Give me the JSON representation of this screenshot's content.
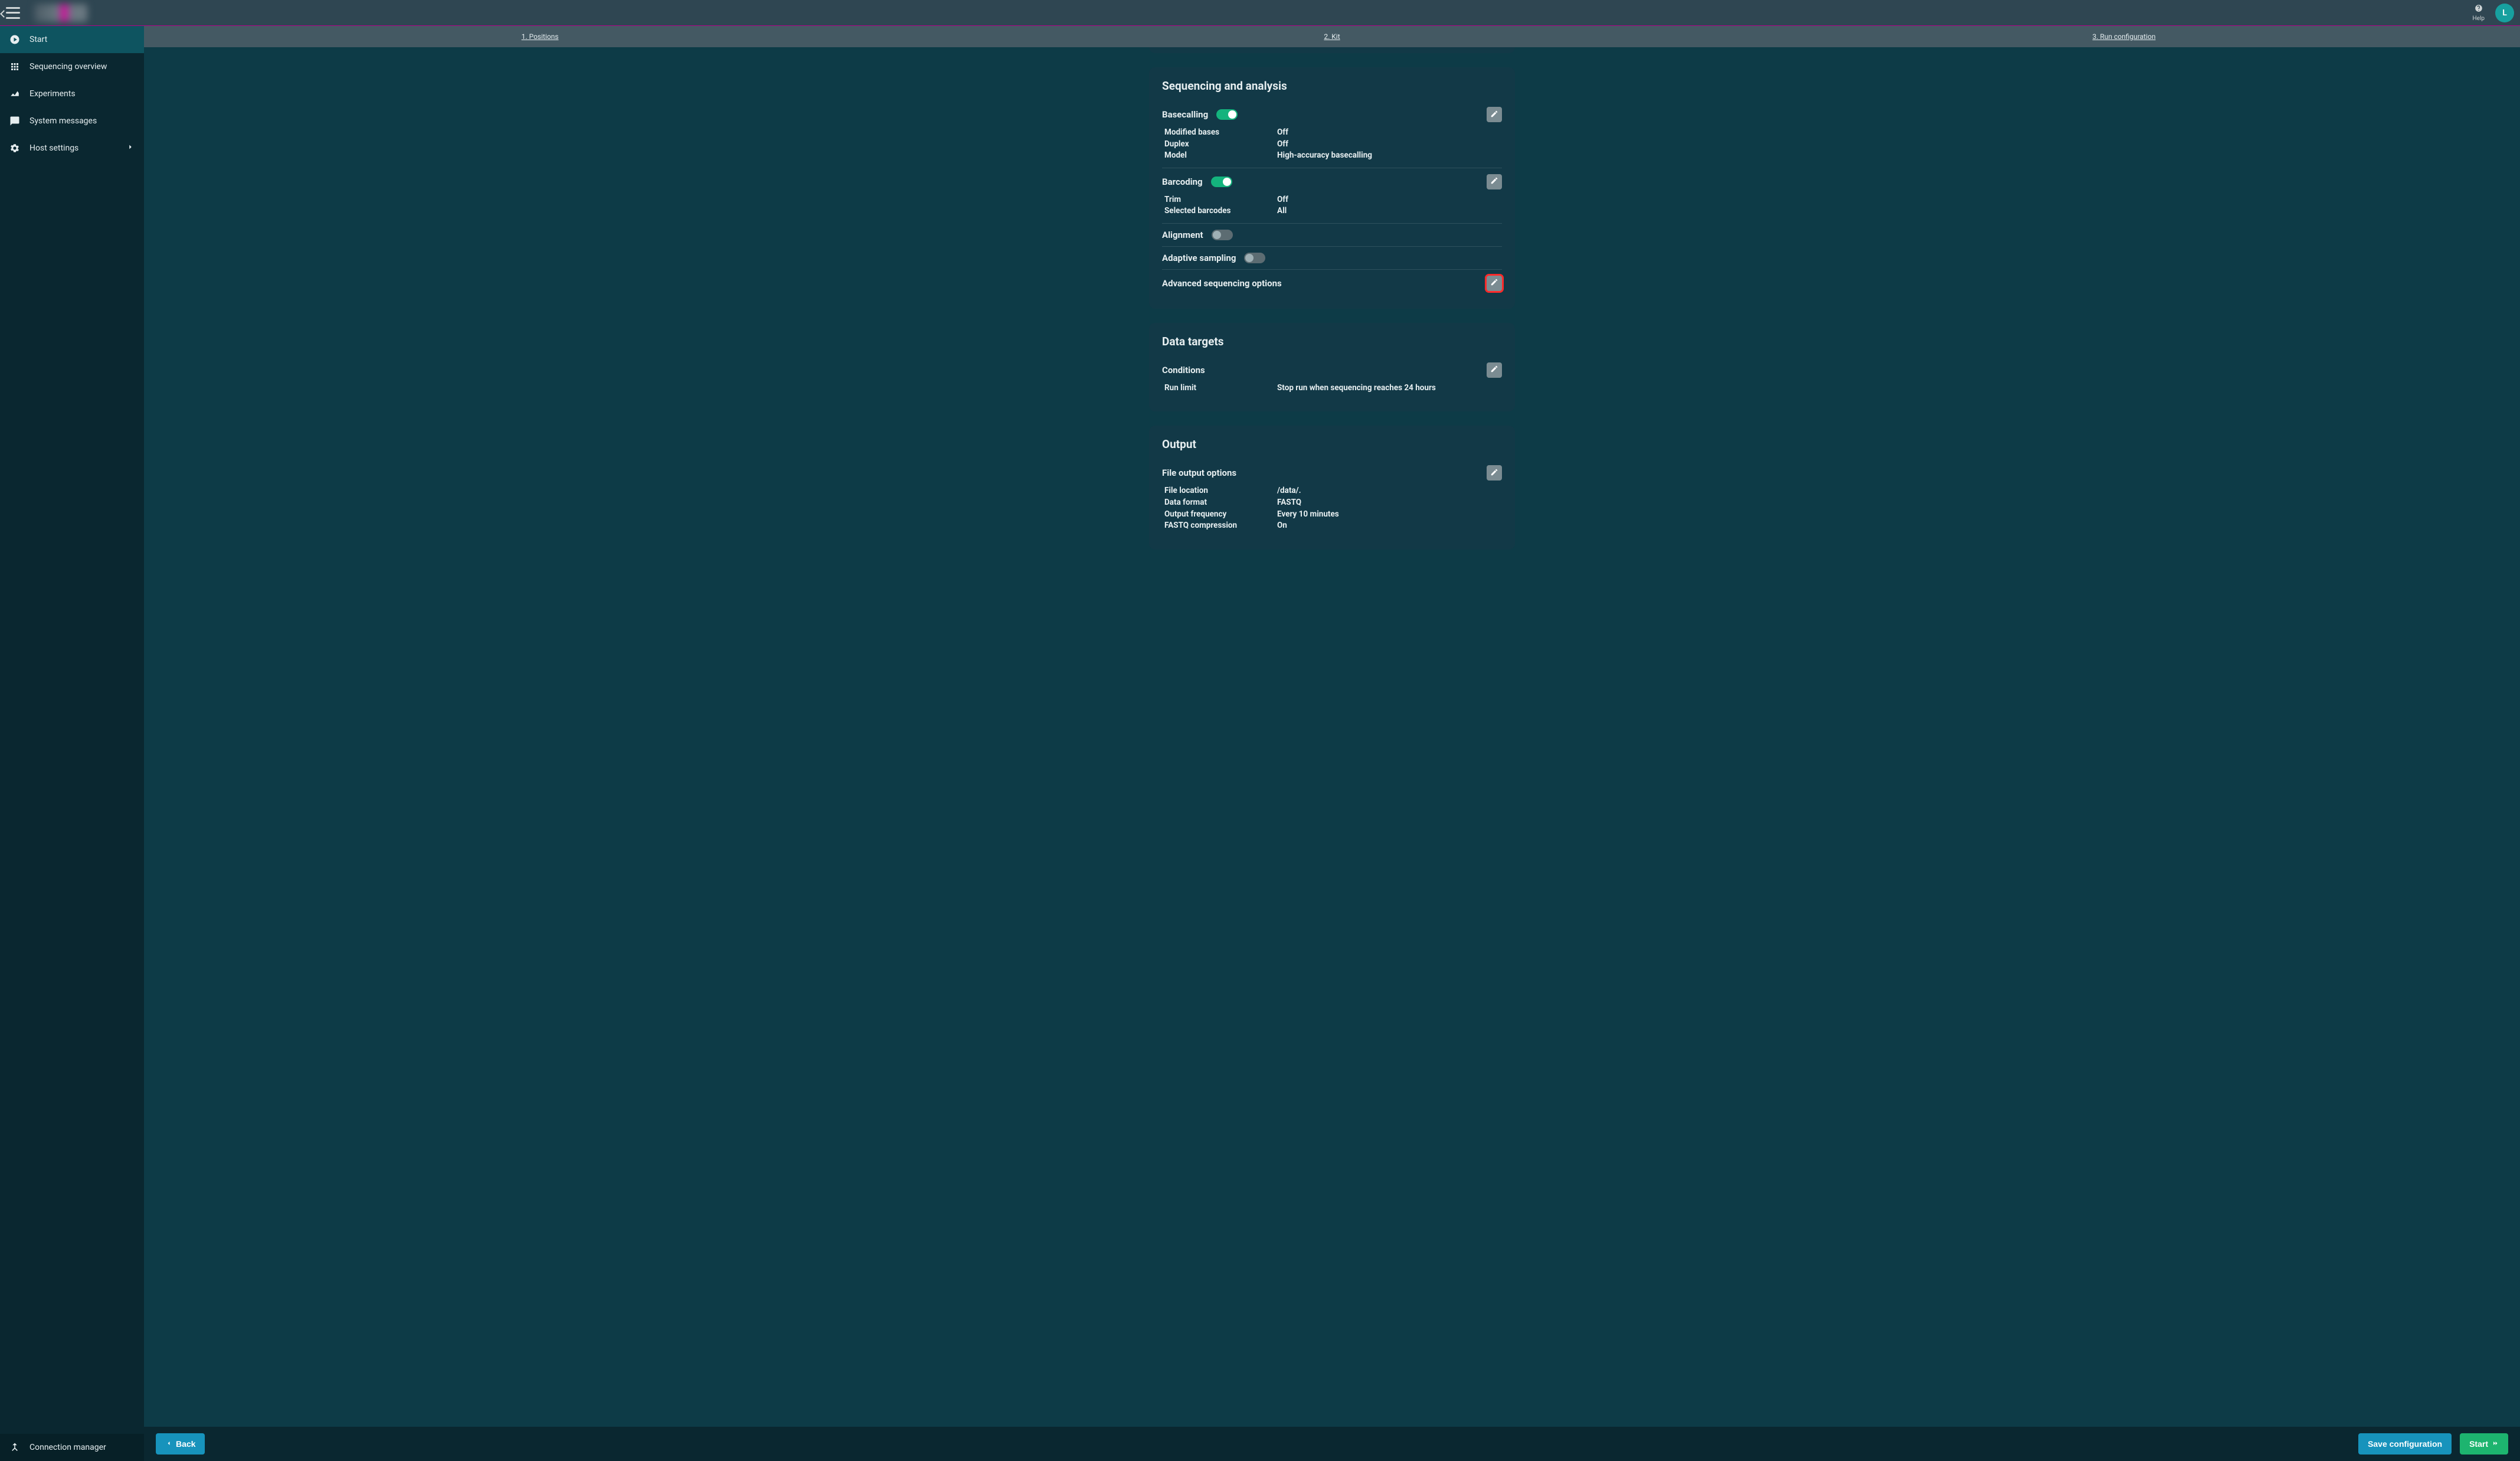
{
  "topbar": {
    "help_label": "Help",
    "avatar_initial": "L"
  },
  "sidebar": {
    "items": [
      {
        "label": "Start",
        "icon": "play-circle",
        "active": true
      },
      {
        "label": "Sequencing overview",
        "icon": "grid",
        "active": false
      },
      {
        "label": "Experiments",
        "icon": "sparkline",
        "active": false
      },
      {
        "label": "System messages",
        "icon": "chat",
        "active": false
      },
      {
        "label": "Host settings",
        "icon": "gear",
        "active": false,
        "has_children": true
      }
    ],
    "footer": {
      "label": "Connection manager",
      "icon": "merge"
    }
  },
  "steps": [
    {
      "label": "1. Positions"
    },
    {
      "label": "2. Kit"
    },
    {
      "label": "3. Run configuration"
    }
  ],
  "panels": {
    "sequencing": {
      "title": "Sequencing and analysis",
      "basecalling": {
        "title": "Basecalling",
        "enabled": true,
        "rows": [
          {
            "k": "Modified bases",
            "v": "Off"
          },
          {
            "k": "Duplex",
            "v": "Off"
          },
          {
            "k": "Model",
            "v": "High-accuracy basecalling"
          }
        ]
      },
      "barcoding": {
        "title": "Barcoding",
        "enabled": true,
        "rows": [
          {
            "k": "Trim",
            "v": "Off"
          },
          {
            "k": "Selected barcodes",
            "v": "All"
          }
        ]
      },
      "alignment": {
        "title": "Alignment",
        "enabled": false
      },
      "adaptive": {
        "title": "Adaptive sampling",
        "enabled": false
      },
      "advanced": {
        "title": "Advanced sequencing options"
      }
    },
    "data_targets": {
      "title": "Data targets",
      "conditions": {
        "title": "Conditions",
        "rows": [
          {
            "k": "Run limit",
            "v": "Stop run when sequencing reaches 24 hours"
          }
        ]
      }
    },
    "output": {
      "title": "Output",
      "file_output": {
        "title": "File output options",
        "rows": [
          {
            "k": "File location",
            "v": "/data/."
          },
          {
            "k": "Data format",
            "v": "FASTQ"
          },
          {
            "k": "Output frequency",
            "v": "Every 10 minutes"
          },
          {
            "k": "FASTQ compression",
            "v": "On"
          }
        ]
      }
    }
  },
  "footer": {
    "back_label": "Back",
    "save_label": "Save configuration",
    "start_label": "Start"
  }
}
